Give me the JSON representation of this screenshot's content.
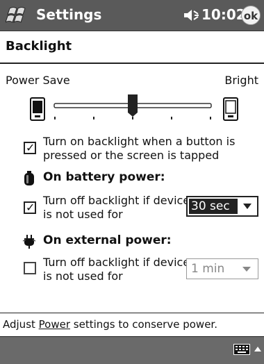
{
  "titlebar": {
    "title": "Settings",
    "time": "10:02",
    "ok_label": "ok"
  },
  "page": {
    "header": "Backlight"
  },
  "brightness": {
    "left_label": "Power Save",
    "right_label": "Bright",
    "level_fraction": 0.5
  },
  "options": {
    "button_tap": {
      "checked": true,
      "line1": "Turn on backlight when a button is",
      "line2": "pressed or the screen is tapped"
    },
    "battery": {
      "heading": "On battery power:",
      "checked": true,
      "line1": "Turn off backlight if device",
      "line2": "is not used for",
      "dropdown_value": "30 sec"
    },
    "external": {
      "heading": "On external power:",
      "checked": false,
      "line1": "Turn off backlight if device",
      "line2": "is not used for",
      "dropdown_value": "1 min"
    }
  },
  "footer": {
    "prefix": "Adjust ",
    "link": "Power",
    "suffix": " settings to conserve power."
  },
  "icons": [
    "windows-start-icon",
    "volume-icon",
    "ok-button",
    "dim-device-icon",
    "bright-device-icon",
    "battery-icon",
    "ac-plug-icon",
    "keyboard-icon",
    "arrow-up-icon"
  ]
}
